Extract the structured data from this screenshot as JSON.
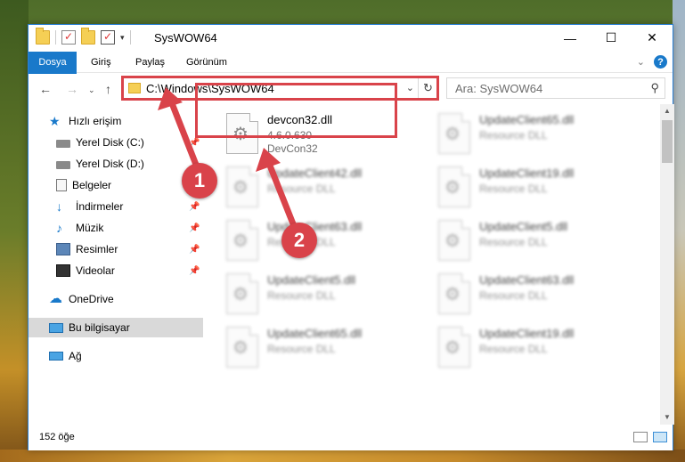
{
  "window": {
    "title": "SysWOW64",
    "controls": {
      "minimize": "—",
      "maximize": "☐",
      "close": "✕"
    }
  },
  "ribbon": {
    "tabs": [
      "Dosya",
      "Giriş",
      "Paylaş",
      "Görünüm"
    ],
    "help": "?",
    "expand": "⌄"
  },
  "address": {
    "path": "C:\\Windows\\SysWOW64",
    "search_placeholder": "Ara: SysWOW64"
  },
  "nav": {
    "items": [
      {
        "label": "Hızlı erişim",
        "icon": "star-icon",
        "pinned": false
      },
      {
        "label": "Yerel Disk (C:)",
        "icon": "disk-icon",
        "pinned": true
      },
      {
        "label": "Yerel Disk (D:)",
        "icon": "disk-icon",
        "pinned": false
      },
      {
        "label": "Belgeler",
        "icon": "document-icon",
        "pinned": false
      },
      {
        "label": "İndirmeler",
        "icon": "download-icon",
        "pinned": true
      },
      {
        "label": "Müzik",
        "icon": "music-icon",
        "pinned": true
      },
      {
        "label": "Resimler",
        "icon": "pictures-icon",
        "pinned": true
      },
      {
        "label": "Videolar",
        "icon": "videos-icon",
        "pinned": true
      },
      {
        "label": "OneDrive",
        "icon": "cloud-icon",
        "pinned": false
      },
      {
        "label": "Bu bilgisayar",
        "icon": "computer-icon",
        "pinned": false,
        "selected": true
      },
      {
        "label": "Ağ",
        "icon": "network-icon",
        "pinned": false
      }
    ]
  },
  "files": {
    "selected": {
      "name": "devcon32.dll",
      "version": "4.6.0.630",
      "description": "DevCon32"
    },
    "left_column": [
      {
        "name": "UpdateClient42.dll",
        "type": "Resource DLL"
      },
      {
        "name": "UpdateClient63.dll",
        "type": "Resource DLL"
      },
      {
        "name": "UpdateClient5.dll",
        "type": "Resource DLL"
      },
      {
        "name": "UpdateClient65.dll",
        "type": "Resource DLL"
      }
    ],
    "right_column": [
      {
        "name": "UpdateClient65.dll",
        "type": "Resource DLL"
      },
      {
        "name": "UpdateClient19.dll",
        "type": "Resource DLL"
      },
      {
        "name": "UpdateClient5.dll",
        "type": "Resource DLL"
      },
      {
        "name": "UpdateClient63.dll",
        "type": "Resource DLL"
      },
      {
        "name": "UpdateClient19.dll",
        "type": "Resource DLL"
      }
    ]
  },
  "status": {
    "count": "152 öğe"
  },
  "annotations": {
    "step1": "1",
    "step2": "2",
    "color": "#d9434a"
  }
}
